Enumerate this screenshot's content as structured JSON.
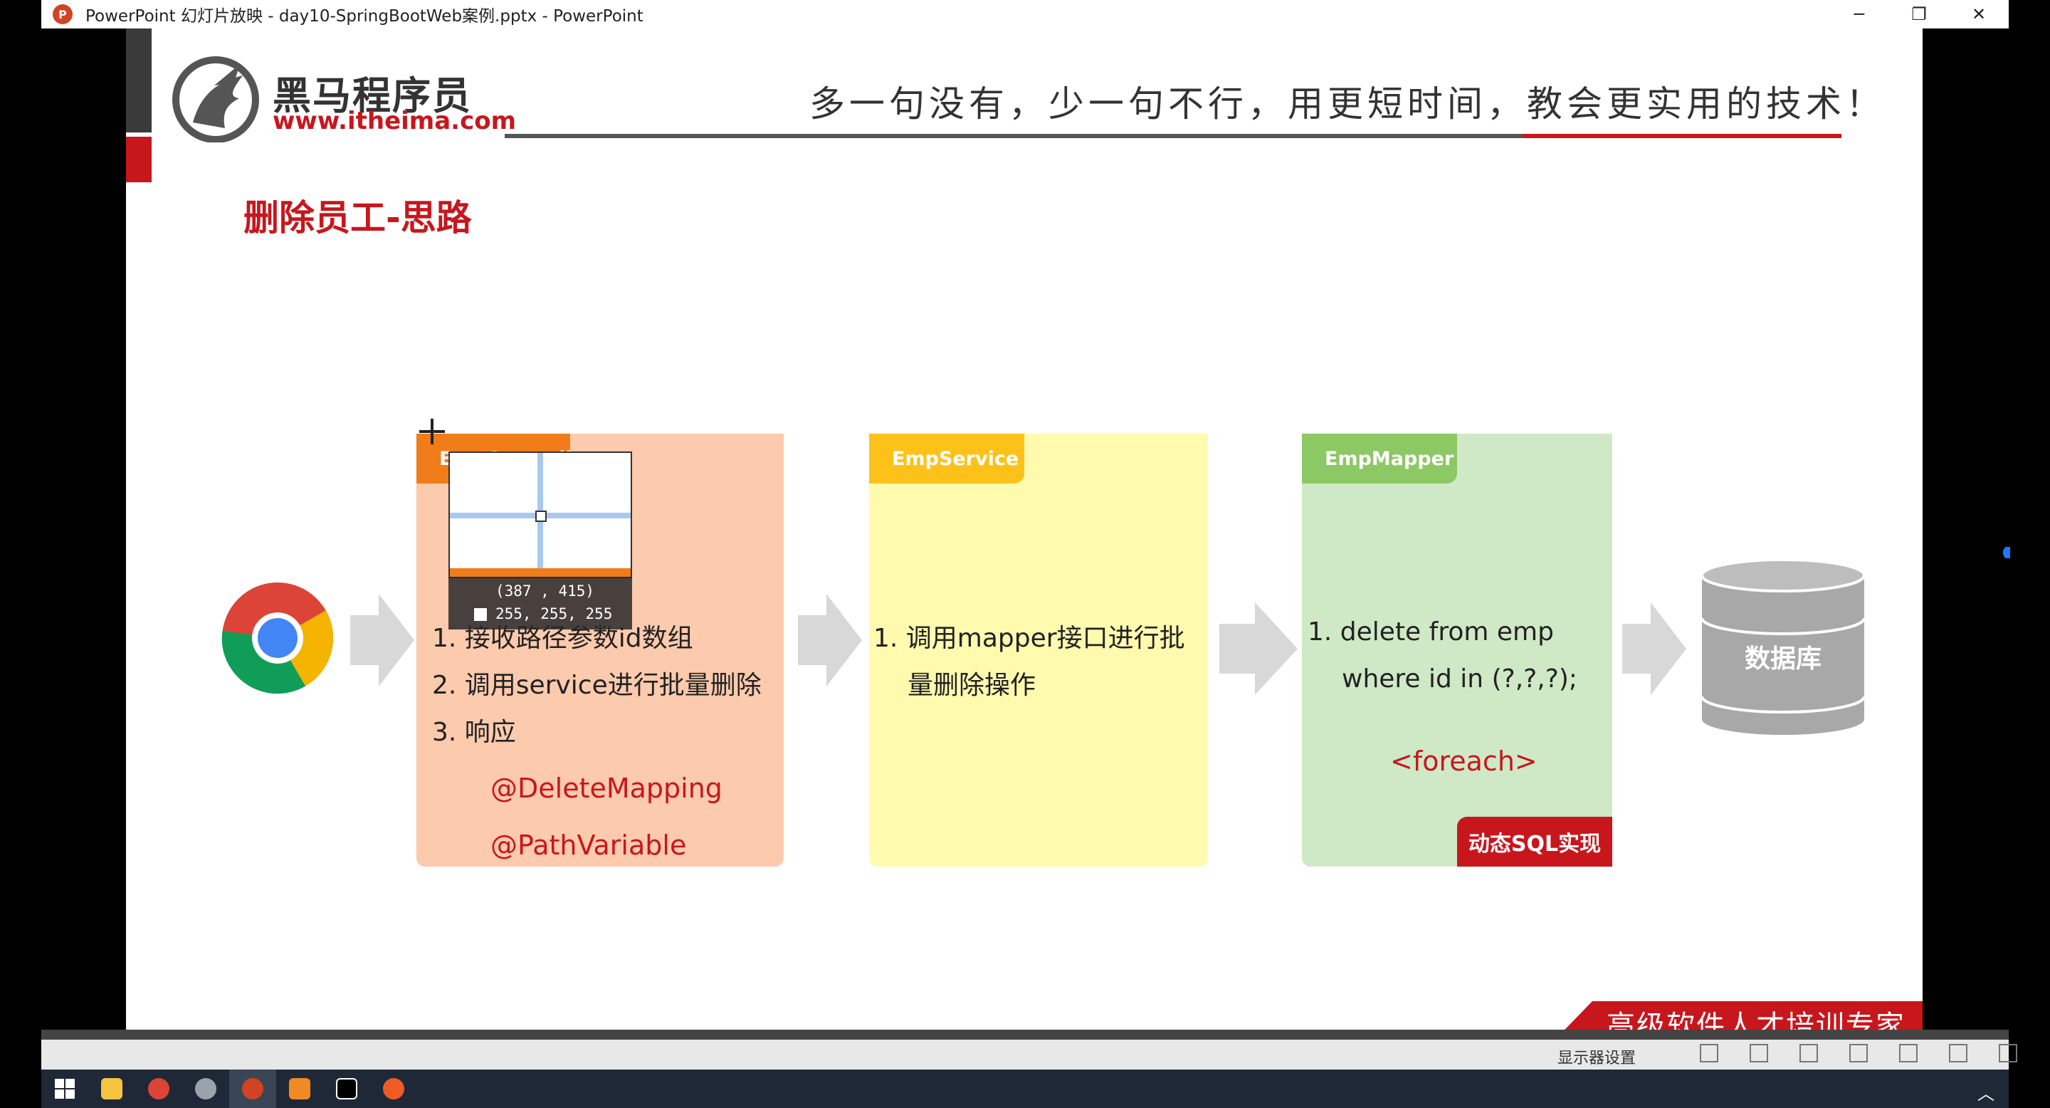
{
  "window": {
    "title": "PowerPoint 幻灯片放映  -  day10-SpringBootWeb案例.pptx - PowerPoint",
    "minimize_glyph": "─",
    "restore_glyph": "❐",
    "close_glyph": "✕"
  },
  "slide": {
    "logo_name": "黑马程序员",
    "logo_url": "www.itheima.com",
    "slogan": "多一句没有，少一句不行，用更短时间，教会更实用的技术！",
    "title": "删除员工-思路",
    "controller": {
      "tab_label": "EmpController",
      "items": [
        "1.  接收路径参数id数组",
        "2.  调用service进行批量删除",
        "3.  响应"
      ],
      "annotations": [
        "@DeleteMapping",
        "@PathVariable"
      ]
    },
    "service": {
      "tab_label": "EmpService",
      "item_line1": "1.  调用mapper接口进行批",
      "item_line2": "量删除操作"
    },
    "mapper": {
      "tab_label": "EmpMapper",
      "item_line1": "1.  delete from emp",
      "item_line2": "where id in (?,?,?);",
      "annotation": "<foreach>",
      "badge": "动态SQL实现"
    },
    "database_label": "数据库",
    "banner": "高级软件人才培训专家"
  },
  "magnifier": {
    "coords": "(387 , 415)",
    "rgb": "255, 255, 255"
  },
  "statusbar": {
    "display_settings": "显示器设置"
  },
  "colors": {
    "brand_red": "#c8161d",
    "controller_tab": "#f07d1a",
    "controller_bg": "#fccaad",
    "service_tab": "#fdc21a",
    "service_bg": "#fffaae",
    "mapper_tab": "#8cc863",
    "mapper_bg": "#cfe9c6"
  },
  "icons": [
    "powerpoint-icon",
    "chrome-icon",
    "arrow-right-icon",
    "database-icon",
    "crosshair-icon",
    "windows-start-icon",
    "file-explorer-icon",
    "intellij-icon"
  ]
}
